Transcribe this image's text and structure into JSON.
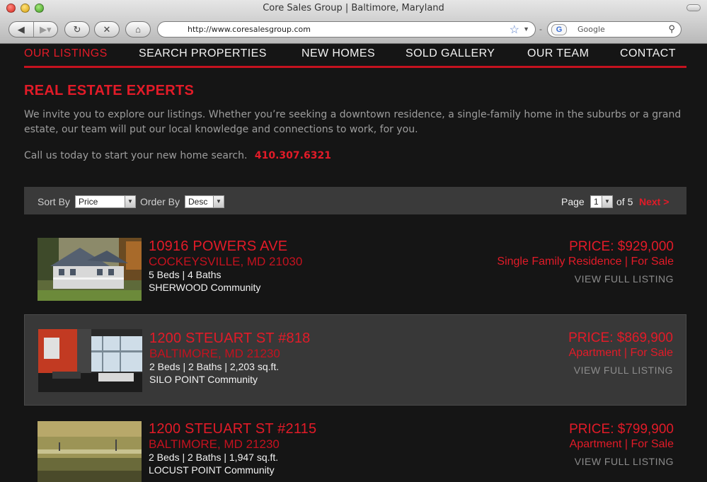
{
  "browser": {
    "window_title": "Core Sales Group | Baltimore, Maryland",
    "url": "http://www.coresalesgroup.com",
    "search_placeholder": "Google"
  },
  "nav": {
    "items": [
      "OUR LISTINGS",
      "SEARCH PROPERTIES",
      "NEW HOMES",
      "SOLD GALLERY",
      "OUR TEAM",
      "CONTACT"
    ],
    "active_index": 0
  },
  "intro": {
    "headline": "REAL ESTATE EXPERTS",
    "body": "We invite you to explore our listings. Whether you’re seeking a downtown residence, a single-family home in the suburbs or a grand estate, our team will put our local knowledge and connections to work, for you.",
    "call_text": "Call us today to start your new home search.",
    "phone": "410.307.6321"
  },
  "sortbar": {
    "sort_label": "Sort By",
    "sort_value": "Price",
    "order_label": "Order By",
    "order_value": "Desc",
    "page_label": "Page",
    "page_value": "1",
    "of_label": "of 5",
    "next_label": "Next >"
  },
  "listings": [
    {
      "address": "10916 POWERS AVE",
      "city": "COCKEYSVILLE, MD 21030",
      "specs": "5 Beds | 4 Baths",
      "community": "SHERWOOD Community",
      "price": "PRICE: $929,000",
      "type": "Single Family Residence | For Sale",
      "view": "VIEW FULL LISTING"
    },
    {
      "address": "1200 STEUART ST #818",
      "city": "BALTIMORE, MD 21230",
      "specs": "2 Beds | 2 Baths | 2,203 sq.ft.",
      "community": "SILO POINT Community",
      "price": "PRICE: $869,900",
      "type": "Apartment | For Sale",
      "view": "VIEW FULL LISTING"
    },
    {
      "address": "1200 STEUART ST #2115",
      "city": "BALTIMORE, MD 21230",
      "specs": "2 Beds | 2 Baths | 1,947 sq.ft.",
      "community": "LOCUST POINT Community",
      "price": "PRICE: $799,900",
      "type": "Apartment | For Sale",
      "view": "VIEW FULL LISTING"
    }
  ],
  "colors": {
    "accent": "#e21b28",
    "background": "#151515",
    "highlight_row": "#383838"
  }
}
